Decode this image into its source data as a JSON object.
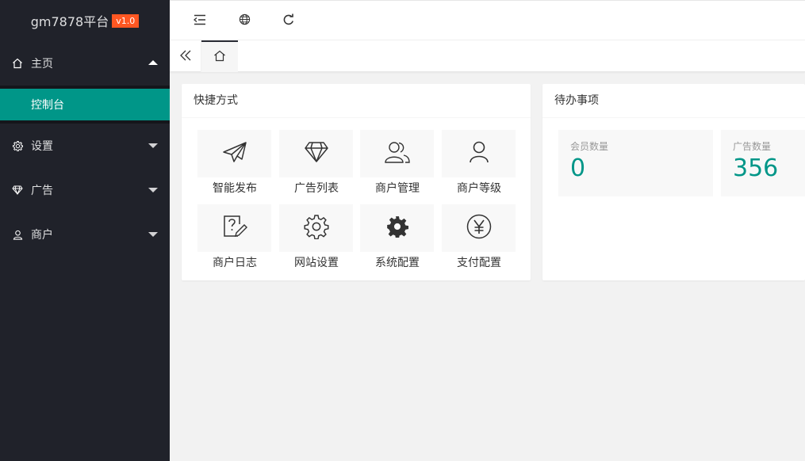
{
  "brand": {
    "name": "gm7878平台",
    "version": "v1.0"
  },
  "sidebar": {
    "items": [
      {
        "label": "主页",
        "icon": "home-icon",
        "expanded": true,
        "children": [
          {
            "label": "控制台",
            "active": true
          }
        ]
      },
      {
        "label": "设置",
        "icon": "gear-icon"
      },
      {
        "label": "广告",
        "icon": "diamond-icon"
      },
      {
        "label": "商户",
        "icon": "user-icon"
      }
    ]
  },
  "header": {
    "icons": [
      "shrink-menu-icon",
      "globe-icon",
      "refresh-icon"
    ]
  },
  "tabs": {
    "icons": [
      "double-chevron-left-icon",
      "home-icon"
    ]
  },
  "shortcuts": {
    "title": "快捷方式",
    "items": [
      {
        "label": "智能发布",
        "icon": "paper-plane-icon"
      },
      {
        "label": "广告列表",
        "icon": "diamond-icon"
      },
      {
        "label": "商户管理",
        "icon": "users-icon"
      },
      {
        "label": "商户等级",
        "icon": "user-icon"
      },
      {
        "label": "商户日志",
        "icon": "question-edit-icon"
      },
      {
        "label": "网站设置",
        "icon": "gear-outline-icon"
      },
      {
        "label": "系统配置",
        "icon": "gear-filled-icon"
      },
      {
        "label": "支付配置",
        "icon": "yen-circle-icon"
      }
    ]
  },
  "todo": {
    "title": "待办事项",
    "stats": [
      {
        "label": "会员数量",
        "value": "0"
      },
      {
        "label": "广告数量",
        "value": "356"
      }
    ]
  },
  "colors": {
    "sidebar_bg": "#20222a",
    "accent": "#009688",
    "version_badge": "#ff5722"
  }
}
